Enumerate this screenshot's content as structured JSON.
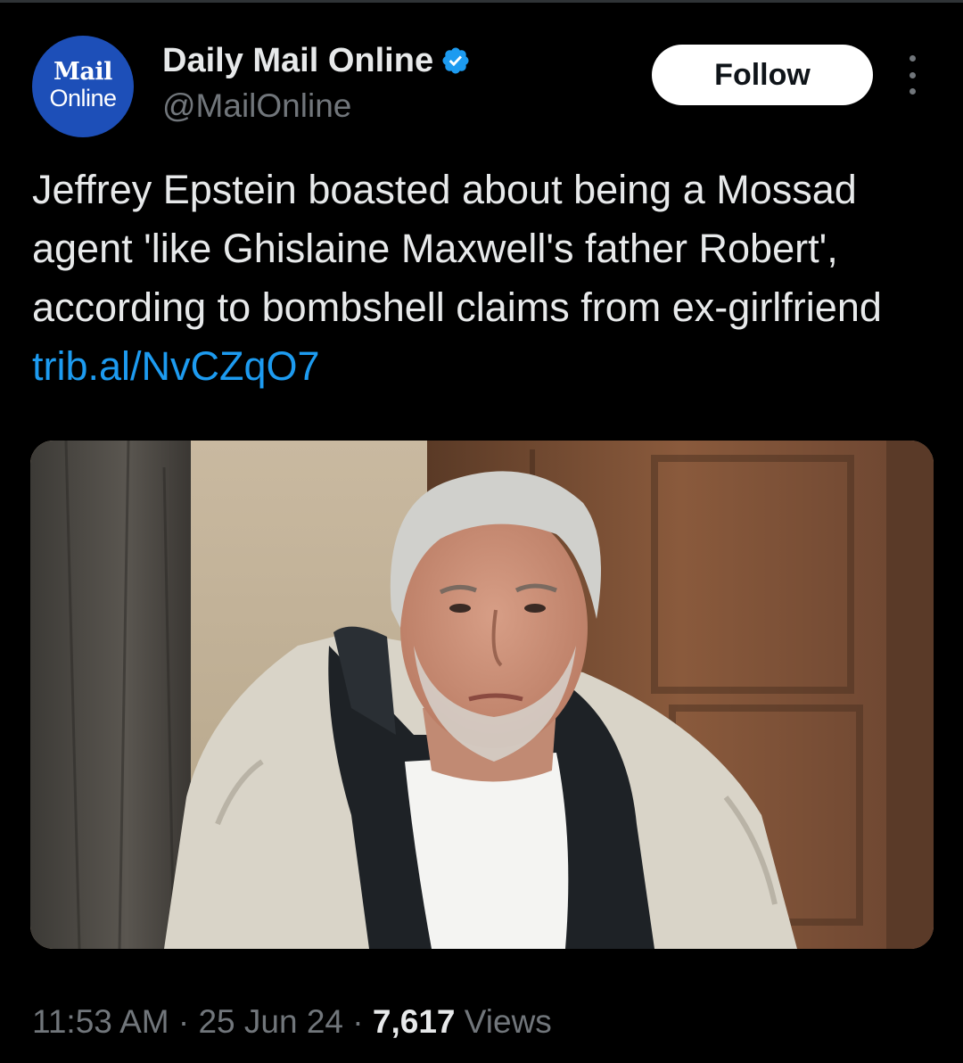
{
  "tweet": {
    "avatar": {
      "logo_top": "Mail",
      "logo_bottom": "Online",
      "color": "#1d4fb8"
    },
    "author_name": "Daily Mail Online",
    "verified": true,
    "handle": "@MailOnline",
    "follow_label": "Follow",
    "more_icon": "more-vertical-icon",
    "text": "Jeffrey Epstein boasted about being a Mossad agent 'like Ghislaine Maxwell's father Robert', according to bombshell claims from ex-girlfriend ",
    "link_text": "trib.al/NvCZqO7",
    "time": "11:53 AM",
    "separator": " · ",
    "date": "25 Jun 24",
    "views_count": "7,617",
    "views_label": " Views"
  },
  "colors": {
    "background": "#000000",
    "text": "#e7e9ea",
    "muted": "#71767b",
    "link": "#1d9bf0",
    "verified": "#1d9bf0"
  }
}
